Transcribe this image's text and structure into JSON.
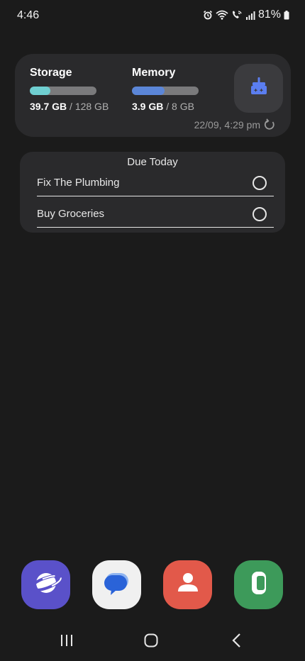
{
  "status_bar": {
    "time": "4:46",
    "battery": "81%"
  },
  "device_care": {
    "storage": {
      "title": "Storage",
      "used": "39.7 GB",
      "separator": " / ",
      "total": "128 GB",
      "fill_fraction": 0.31,
      "bar_color": "#6fcfd1"
    },
    "memory": {
      "title": "Memory",
      "used": "3.9 GB",
      "separator": " / ",
      "total": "8 GB",
      "fill_fraction": 0.49,
      "bar_color": "#5b86d8"
    },
    "updated": "22/09, 4:29 pm",
    "clean_icon": "broom-sparkle-icon",
    "accent": "#5b7ef0"
  },
  "reminders": {
    "title": "Due Today",
    "items": [
      {
        "label": "Fix The Plumbing"
      },
      {
        "label": "Buy Groceries"
      }
    ]
  },
  "dock": {
    "apps": [
      {
        "icon": "internet-browser-icon",
        "color": "#5a51c9"
      },
      {
        "icon": "messages-icon",
        "color": "#f0f0f0"
      },
      {
        "icon": "contacts-icon",
        "color": "#e2594a"
      },
      {
        "icon": "phone-icon",
        "color": "#3d9a5a"
      }
    ]
  },
  "nav": {
    "recents_icon": "recents-icon",
    "home_icon": "home-icon",
    "back_icon": "back-icon"
  }
}
